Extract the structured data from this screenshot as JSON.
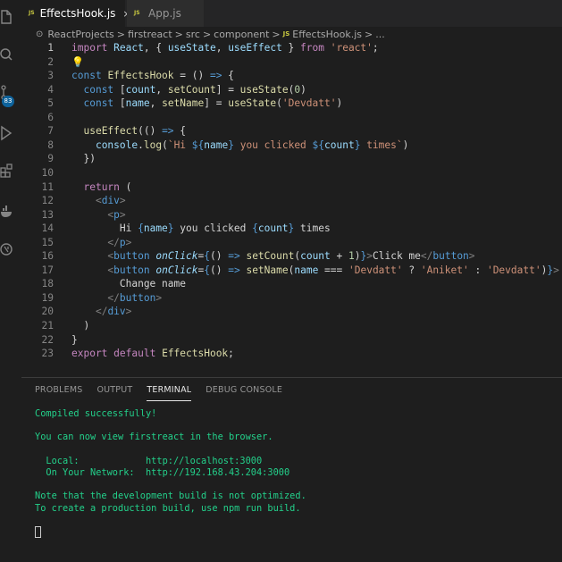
{
  "tabs": [
    {
      "label": "EffectsHook.js",
      "active": true,
      "icon": "js-file-icon"
    },
    {
      "label": "App.js",
      "active": false,
      "icon": "js-file-icon"
    }
  ],
  "tab_close": "×",
  "js_label": "JS",
  "breadcrumb": {
    "parts": [
      "ReactProjects",
      "firstreact",
      "src",
      "component",
      "EffectsHook.js",
      "..."
    ],
    "separator": ">"
  },
  "activity": {
    "badge": "83"
  },
  "code": {
    "current_line": 1,
    "lines": [
      {
        "n": "1",
        "tokens": [
          [
            "kw2",
            "import"
          ],
          [
            "pl",
            " "
          ],
          [
            "vr",
            "React"
          ],
          [
            "pl",
            ", { "
          ],
          [
            "vr",
            "useState"
          ],
          [
            "pl",
            ", "
          ],
          [
            "vr",
            "useEffect"
          ],
          [
            "pl",
            " } "
          ],
          [
            "kw2",
            "from"
          ],
          [
            "pl",
            " "
          ],
          [
            "st",
            "'react'"
          ],
          [
            "pl",
            ";"
          ]
        ]
      },
      {
        "n": "2",
        "tokens": [
          [
            "bulb",
            "💡"
          ]
        ]
      },
      {
        "n": "3",
        "tokens": [
          [
            "kw",
            "const"
          ],
          [
            "pl",
            " "
          ],
          [
            "fn",
            "EffectsHook"
          ],
          [
            "pl",
            " = () "
          ],
          [
            "kw",
            "=>"
          ],
          [
            "pl",
            " {"
          ]
        ]
      },
      {
        "n": "4",
        "tokens": [
          [
            "pl",
            "  "
          ],
          [
            "kw",
            "const"
          ],
          [
            "pl",
            " ["
          ],
          [
            "vr",
            "count"
          ],
          [
            "pl",
            ", "
          ],
          [
            "fn",
            "setCount"
          ],
          [
            "pl",
            "] = "
          ],
          [
            "fn",
            "useState"
          ],
          [
            "pl",
            "("
          ],
          [
            "nm",
            "0"
          ],
          [
            "pl",
            ")"
          ]
        ]
      },
      {
        "n": "5",
        "tokens": [
          [
            "pl",
            "  "
          ],
          [
            "kw",
            "const"
          ],
          [
            "pl",
            " ["
          ],
          [
            "vr",
            "name"
          ],
          [
            "pl",
            ", "
          ],
          [
            "fn",
            "setName"
          ],
          [
            "pl",
            "] = "
          ],
          [
            "fn",
            "useState"
          ],
          [
            "pl",
            "("
          ],
          [
            "st",
            "'Devdatt'"
          ],
          [
            "pl",
            ")"
          ]
        ]
      },
      {
        "n": "6",
        "tokens": []
      },
      {
        "n": "7",
        "tokens": [
          [
            "pl",
            "  "
          ],
          [
            "fn",
            "useEffect"
          ],
          [
            "pl",
            "(() "
          ],
          [
            "kw",
            "=>"
          ],
          [
            "pl",
            " {"
          ]
        ]
      },
      {
        "n": "8",
        "tokens": [
          [
            "pl",
            "    "
          ],
          [
            "vr",
            "console"
          ],
          [
            "pl",
            "."
          ],
          [
            "fn",
            "log"
          ],
          [
            "pl",
            "("
          ],
          [
            "st",
            "`Hi "
          ],
          [
            "kw",
            "${"
          ],
          [
            "vr",
            "name"
          ],
          [
            "kw",
            "}"
          ],
          [
            "st",
            " you clicked "
          ],
          [
            "kw",
            "${"
          ],
          [
            "vr",
            "count"
          ],
          [
            "kw",
            "}"
          ],
          [
            "st",
            " times`"
          ],
          [
            "pl",
            ")"
          ]
        ]
      },
      {
        "n": "9",
        "tokens": [
          [
            "pl",
            "  })"
          ]
        ]
      },
      {
        "n": "10",
        "tokens": []
      },
      {
        "n": "11",
        "tokens": [
          [
            "pl",
            "  "
          ],
          [
            "kw2",
            "return"
          ],
          [
            "pl",
            " ("
          ]
        ]
      },
      {
        "n": "12",
        "tokens": [
          [
            "pl",
            "    "
          ],
          [
            "pn",
            "<"
          ],
          [
            "tg",
            "div"
          ],
          [
            "pn",
            ">"
          ]
        ]
      },
      {
        "n": "13",
        "tokens": [
          [
            "pl",
            "      "
          ],
          [
            "pn",
            "<"
          ],
          [
            "tg",
            "p"
          ],
          [
            "pn",
            ">"
          ]
        ]
      },
      {
        "n": "14",
        "tokens": [
          [
            "pl",
            "        Hi "
          ],
          [
            "kw",
            "{"
          ],
          [
            "vr",
            "name"
          ],
          [
            "kw",
            "}"
          ],
          [
            "pl",
            " you clicked "
          ],
          [
            "kw",
            "{"
          ],
          [
            "vr",
            "count"
          ],
          [
            "kw",
            "}"
          ],
          [
            "pl",
            " times"
          ]
        ]
      },
      {
        "n": "15",
        "tokens": [
          [
            "pl",
            "      "
          ],
          [
            "pn",
            "</"
          ],
          [
            "tg",
            "p"
          ],
          [
            "pn",
            ">"
          ]
        ]
      },
      {
        "n": "16",
        "tokens": [
          [
            "pl",
            "      "
          ],
          [
            "pn",
            "<"
          ],
          [
            "tg",
            "button"
          ],
          [
            "pl",
            " "
          ],
          [
            "at",
            "onClick"
          ],
          [
            "pl",
            "="
          ],
          [
            "kw",
            "{"
          ],
          [
            "pl",
            "() "
          ],
          [
            "kw",
            "=>"
          ],
          [
            "pl",
            " "
          ],
          [
            "fn",
            "setCount"
          ],
          [
            "pl",
            "("
          ],
          [
            "vr",
            "count"
          ],
          [
            "pl",
            " + "
          ],
          [
            "nm",
            "1"
          ],
          [
            "pl",
            ")"
          ],
          [
            "kw",
            "}"
          ],
          [
            "pn",
            ">"
          ],
          [
            "pl",
            "Click me"
          ],
          [
            "pn",
            "</"
          ],
          [
            "tg",
            "button"
          ],
          [
            "pn",
            ">"
          ]
        ]
      },
      {
        "n": "17",
        "tokens": [
          [
            "pl",
            "      "
          ],
          [
            "pn",
            "<"
          ],
          [
            "tg",
            "button"
          ],
          [
            "pl",
            " "
          ],
          [
            "at",
            "onClick"
          ],
          [
            "pl",
            "="
          ],
          [
            "kw",
            "{"
          ],
          [
            "pl",
            "() "
          ],
          [
            "kw",
            "=>"
          ],
          [
            "pl",
            " "
          ],
          [
            "fn",
            "setName"
          ],
          [
            "pl",
            "("
          ],
          [
            "vr",
            "name"
          ],
          [
            "pl",
            " === "
          ],
          [
            "st",
            "'Devdatt'"
          ],
          [
            "pl",
            " ? "
          ],
          [
            "st",
            "'Aniket'"
          ],
          [
            "pl",
            " : "
          ],
          [
            "st",
            "'Devdatt'"
          ],
          [
            "pl",
            ")"
          ],
          [
            "kw",
            "}"
          ],
          [
            "pn",
            ">"
          ]
        ]
      },
      {
        "n": "18",
        "tokens": [
          [
            "pl",
            "        Change name"
          ]
        ]
      },
      {
        "n": "19",
        "tokens": [
          [
            "pl",
            "      "
          ],
          [
            "pn",
            "</"
          ],
          [
            "tg",
            "button"
          ],
          [
            "pn",
            ">"
          ]
        ]
      },
      {
        "n": "20",
        "tokens": [
          [
            "pl",
            "    "
          ],
          [
            "pn",
            "</"
          ],
          [
            "tg",
            "div"
          ],
          [
            "pn",
            ">"
          ]
        ]
      },
      {
        "n": "21",
        "tokens": [
          [
            "pl",
            "  )"
          ]
        ]
      },
      {
        "n": "22",
        "tokens": [
          [
            "pl",
            "}"
          ]
        ]
      },
      {
        "n": "23",
        "tokens": [
          [
            "kw2",
            "export"
          ],
          [
            "pl",
            " "
          ],
          [
            "kw2",
            "default"
          ],
          [
            "pl",
            " "
          ],
          [
            "fn",
            "EffectsHook"
          ],
          [
            "pl",
            ";"
          ]
        ]
      }
    ]
  },
  "panel": {
    "tabs": [
      {
        "label": "PROBLEMS",
        "active": false
      },
      {
        "label": "OUTPUT",
        "active": false
      },
      {
        "label": "TERMINAL",
        "active": true
      },
      {
        "label": "DEBUG CONSOLE",
        "active": false
      }
    ]
  },
  "terminal": {
    "lines": [
      {
        "text": "Compiled successfully!",
        "color": "green"
      },
      {
        "text": "",
        "color": "white"
      },
      {
        "text": "You can now view firstreact in the browser.",
        "color": "green"
      },
      {
        "text": "",
        "color": "white"
      },
      {
        "text": "  Local:            http://localhost:3000",
        "color": "green"
      },
      {
        "text": "  On Your Network:  http://192.168.43.204:3000",
        "color": "green"
      },
      {
        "text": "",
        "color": "white"
      },
      {
        "text": "Note that the development build is not optimized.",
        "color": "green"
      },
      {
        "text": "To create a production build, use npm run build.",
        "color": "green"
      },
      {
        "text": "",
        "color": "white"
      }
    ]
  },
  "colors": {
    "background": "#1e1e1e",
    "accent": "#0e639c",
    "terminal_green": "#23d18b",
    "keyword": "#569cd6",
    "control": "#c586c0",
    "string": "#ce9178"
  }
}
